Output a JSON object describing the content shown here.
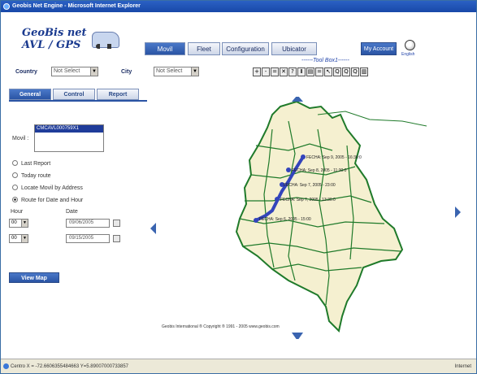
{
  "window": {
    "title": "Geobis Net Engine - Microsoft Internet Explorer"
  },
  "logo": {
    "line1": "GeoBis net",
    "line2": "AVL / GPS"
  },
  "nav": [
    {
      "label": "Movil",
      "active": true
    },
    {
      "label": "Fleet",
      "active": false
    },
    {
      "label": "Configuration",
      "active": false
    },
    {
      "label": "Ubicator",
      "active": false
    }
  ],
  "account": {
    "label": "My Account",
    "language": "English"
  },
  "filters": {
    "country_label": "Country",
    "country_value": "Not Select",
    "city_label": "City",
    "city_value": "Not Select"
  },
  "toolbox": {
    "title": "------Tool Box1------",
    "tools": [
      "+",
      "-",
      "=",
      "✕",
      "?",
      "Ⅱ",
      "▤",
      "=",
      "↖",
      "Q",
      "Q",
      "Q",
      "▥"
    ]
  },
  "tabs": [
    {
      "label": "General",
      "active": true
    },
    {
      "label": "Control",
      "active": false
    },
    {
      "label": "Report",
      "active": false
    }
  ],
  "movil": {
    "label": "Movil :",
    "selected": "CMCAVL000759X1"
  },
  "options": [
    {
      "label": "Last Report",
      "checked": false
    },
    {
      "label": "Today route",
      "checked": false
    },
    {
      "label": "Locate Movil by Address",
      "checked": false
    },
    {
      "label": "Route for Date and Hour",
      "checked": true
    }
  ],
  "datetime": {
    "hour_label": "Hour",
    "date_label": "Date",
    "hour1": "00",
    "date1": "09/06/2005",
    "hour2": "00",
    "date2": "09/15/2005"
  },
  "view_map_button": "View Map",
  "map": {
    "labels": [
      "FECHA: Sep 9, 2005 - 16:30:0",
      "FECHA: Sep 8, 2005 - 11:30:0",
      "FECHA: Sep 7, 2005 - 23:00",
      "FECHA: Sep 7, 2005 - 13:30:0",
      "FECHA: Sep 6, 2005 - 15:00"
    ],
    "copyright": "Geobis International ® Copyright ® 1991 - 2005 www.geobis.com"
  },
  "colors": {
    "nav_active": "#2a54a4",
    "route": "#3344bb",
    "map_fill": "#f5f0d0",
    "border": "#1f7a2a"
  },
  "status": {
    "coords": "Centro X = -72.6606355484663 Y=5.89007000733857",
    "zone": "Internet"
  }
}
